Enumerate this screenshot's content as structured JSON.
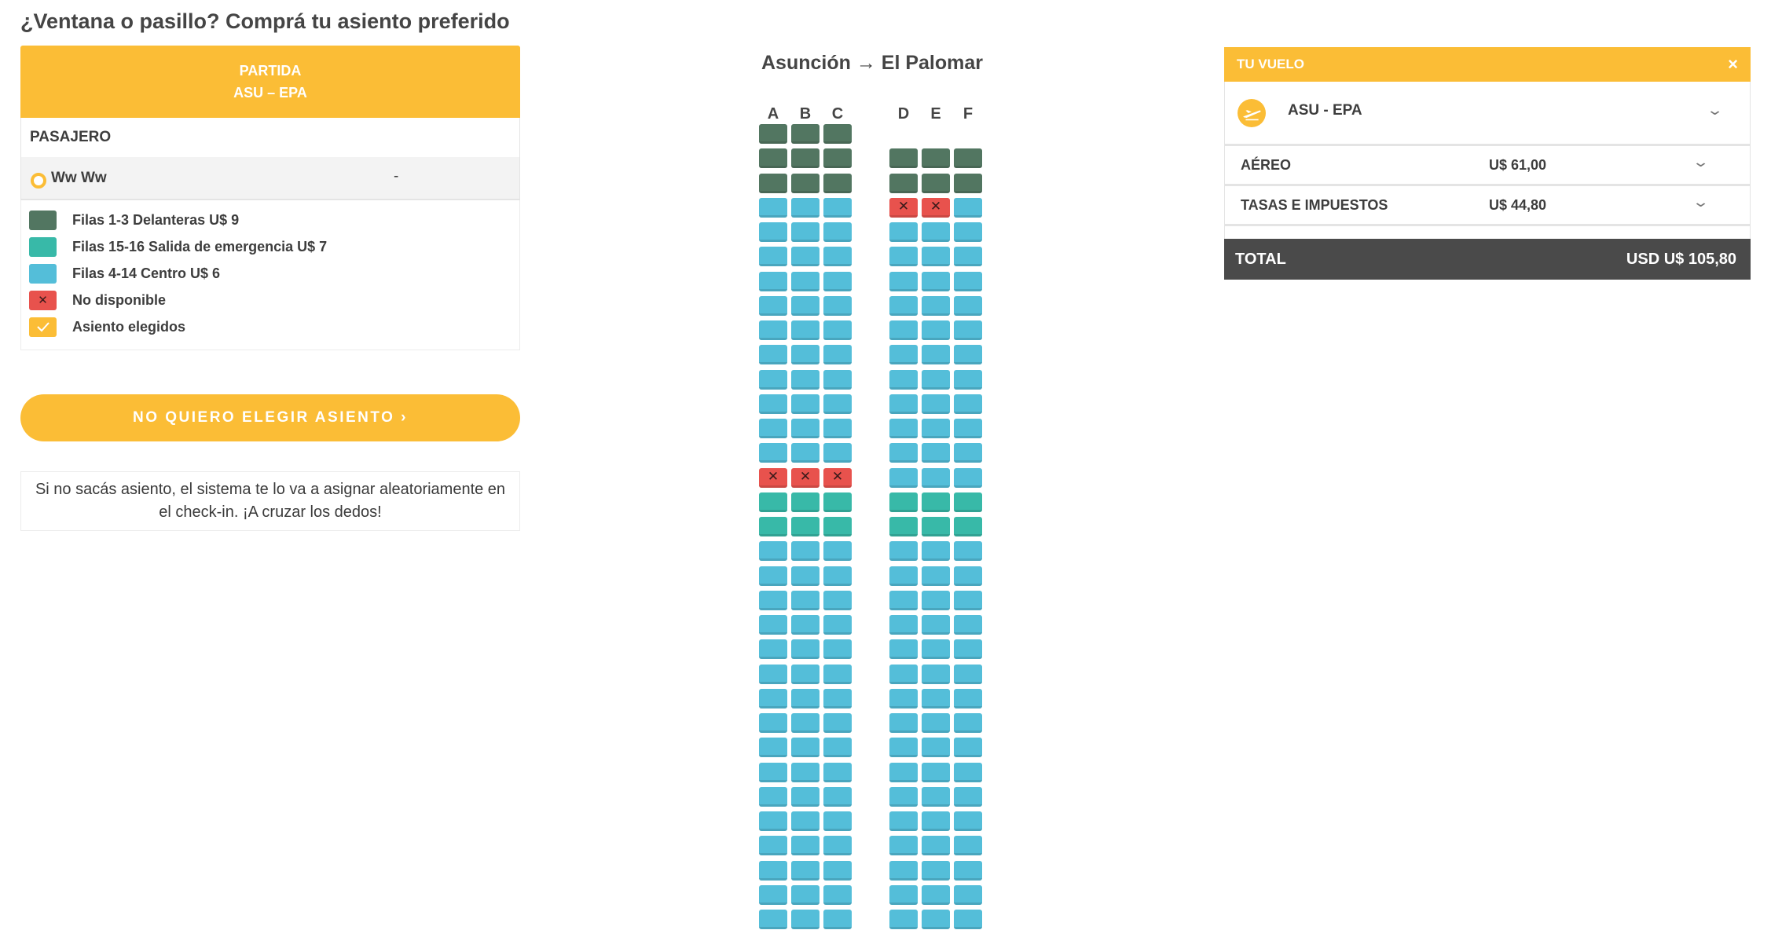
{
  "page": {
    "title": "¿Ventana o pasillo? Comprá tu asiento preferido"
  },
  "leg": {
    "label": "PARTIDA",
    "route": "ASU – EPA"
  },
  "passenger": {
    "header": "PASAJERO",
    "name": "Ww Ww",
    "seat": "-"
  },
  "legend": [
    {
      "label": "Filas 1-3 Delanteras U$ 9",
      "type": "front",
      "color": "#527661"
    },
    {
      "label": "Filas 15-16 Salida de emergencia U$ 7",
      "type": "emergency",
      "color": "#38b9a8"
    },
    {
      "label": "Filas 4-14 Centro U$ 6",
      "type": "center",
      "color": "#54bed9"
    },
    {
      "label": "No disponible",
      "type": "unavailable",
      "color": "#e8524d"
    },
    {
      "label": "Asiento elegidos",
      "type": "selected",
      "color": "#fbbd36"
    }
  ],
  "skip_button": {
    "label": "NO QUIERO ELEGIR ASIENTO ›"
  },
  "info_text": "Si no sacás asiento, el sistema te lo va a asignar aleatoriamente en el check-in. ¡A cruzar los dedos!",
  "seat_map": {
    "title": "Asunción → El Palomar",
    "left_columns": [
      "A",
      "B",
      "C"
    ],
    "right_columns": [
      "D",
      "E",
      "F"
    ],
    "unavailable_symbol": "✕",
    "rows": [
      {
        "left": [
          "front",
          "front",
          "front"
        ],
        "right": null
      },
      {
        "left": [
          "front",
          "front",
          "front"
        ],
        "right": [
          "front",
          "front",
          "front"
        ]
      },
      {
        "left": [
          "front",
          "front",
          "front"
        ],
        "right": [
          "front",
          "front",
          "front"
        ]
      },
      {
        "left": [
          "center",
          "center",
          "center"
        ],
        "right": [
          "unavailable",
          "unavailable",
          "center"
        ]
      },
      {
        "left": [
          "center",
          "center",
          "center"
        ],
        "right": [
          "center",
          "center",
          "center"
        ]
      },
      {
        "left": [
          "center",
          "center",
          "center"
        ],
        "right": [
          "center",
          "center",
          "center"
        ]
      },
      {
        "left": [
          "center",
          "center",
          "center"
        ],
        "right": [
          "center",
          "center",
          "center"
        ]
      },
      {
        "left": [
          "center",
          "center",
          "center"
        ],
        "right": [
          "center",
          "center",
          "center"
        ]
      },
      {
        "left": [
          "center",
          "center",
          "center"
        ],
        "right": [
          "center",
          "center",
          "center"
        ]
      },
      {
        "left": [
          "center",
          "center",
          "center"
        ],
        "right": [
          "center",
          "center",
          "center"
        ]
      },
      {
        "left": [
          "center",
          "center",
          "center"
        ],
        "right": [
          "center",
          "center",
          "center"
        ]
      },
      {
        "left": [
          "center",
          "center",
          "center"
        ],
        "right": [
          "center",
          "center",
          "center"
        ]
      },
      {
        "left": [
          "center",
          "center",
          "center"
        ],
        "right": [
          "center",
          "center",
          "center"
        ]
      },
      {
        "left": [
          "center",
          "center",
          "center"
        ],
        "right": [
          "center",
          "center",
          "center"
        ]
      },
      {
        "left": [
          "unavailable",
          "unavailable",
          "unavailable"
        ],
        "right": [
          "center",
          "center",
          "center"
        ]
      },
      {
        "left": [
          "emergency",
          "emergency",
          "emergency"
        ],
        "right": [
          "emergency",
          "emergency",
          "emergency"
        ]
      },
      {
        "left": [
          "emergency",
          "emergency",
          "emergency"
        ],
        "right": [
          "emergency",
          "emergency",
          "emergency"
        ]
      },
      {
        "left": [
          "center",
          "center",
          "center"
        ],
        "right": [
          "center",
          "center",
          "center"
        ]
      },
      {
        "left": [
          "center",
          "center",
          "center"
        ],
        "right": [
          "center",
          "center",
          "center"
        ]
      },
      {
        "left": [
          "center",
          "center",
          "center"
        ],
        "right": [
          "center",
          "center",
          "center"
        ]
      },
      {
        "left": [
          "center",
          "center",
          "center"
        ],
        "right": [
          "center",
          "center",
          "center"
        ]
      },
      {
        "left": [
          "center",
          "center",
          "center"
        ],
        "right": [
          "center",
          "center",
          "center"
        ]
      },
      {
        "left": [
          "center",
          "center",
          "center"
        ],
        "right": [
          "center",
          "center",
          "center"
        ]
      },
      {
        "left": [
          "center",
          "center",
          "center"
        ],
        "right": [
          "center",
          "center",
          "center"
        ]
      },
      {
        "left": [
          "center",
          "center",
          "center"
        ],
        "right": [
          "center",
          "center",
          "center"
        ]
      },
      {
        "left": [
          "center",
          "center",
          "center"
        ],
        "right": [
          "center",
          "center",
          "center"
        ]
      },
      {
        "left": [
          "center",
          "center",
          "center"
        ],
        "right": [
          "center",
          "center",
          "center"
        ]
      },
      {
        "left": [
          "center",
          "center",
          "center"
        ],
        "right": [
          "center",
          "center",
          "center"
        ]
      },
      {
        "left": [
          "center",
          "center",
          "center"
        ],
        "right": [
          "center",
          "center",
          "center"
        ]
      },
      {
        "left": [
          "center",
          "center",
          "center"
        ],
        "right": [
          "center",
          "center",
          "center"
        ]
      },
      {
        "left": [
          "center",
          "center",
          "center"
        ],
        "right": [
          "center",
          "center",
          "center"
        ]
      },
      {
        "left": [
          "center",
          "center",
          "center"
        ],
        "right": [
          "center",
          "center",
          "center"
        ]
      },
      {
        "left": [
          "center",
          "center",
          "center"
        ],
        "right": [
          "center",
          "center",
          "center"
        ]
      }
    ]
  },
  "summary": {
    "header": "TU VUELO",
    "close_symbol": "×",
    "flight_icon": "plane-icon",
    "flight_route": "ASU - EPA",
    "rows": [
      {
        "label": "AÉREO",
        "value": "U$ 61,00"
      },
      {
        "label": "TASAS E IMPUESTOS",
        "value": "U$ 44,80"
      }
    ],
    "total_label": "TOTAL",
    "total_value": "USD U$ 105,80"
  }
}
